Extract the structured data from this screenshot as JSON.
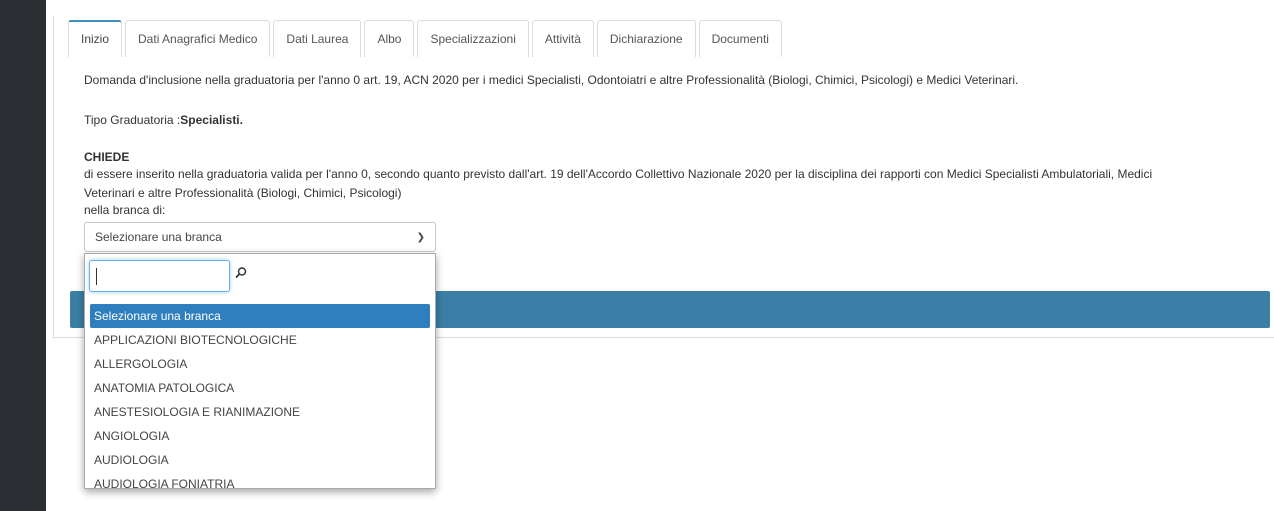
{
  "tabs": [
    "Inizio",
    "Dati Anagrafici Medico",
    "Dati Laurea",
    "Albo",
    "Specializzazioni",
    "Attività",
    "Dichiarazione",
    "Documenti"
  ],
  "content": {
    "intro": "Domanda d'inclusione nella graduatoria per l'anno 0 art. 19, ACN 2020 per i medici Specialisti, Odontoiatri e altre Professionalità (Biologi, Chimici, Psicologi) e Medici Veterinari.",
    "tipo_label": "Tipo Graduatoria :",
    "tipo_value": "Specialisti.",
    "chiede": "CHIEDE",
    "para_line1": "di essere inserito nella graduatoria valida per l'anno 0, secondo quanto previsto dall'art. 19 dell'Accordo Collettivo Nazionale 2020 per la disciplina dei rapporti con Medici Specialisti Ambulatoriali, Medici",
    "para_line2": "Veterinari e altre Professionalità (Biologi, Chimici, Psicologi)",
    "branca_label": "nella branca di:"
  },
  "select": {
    "value": "Selezionare una branca",
    "search_value": "",
    "options": [
      "Selezionare una branca",
      "APPLICAZIONI BIOTECNOLOGICHE",
      "ALLERGOLOGIA",
      "ANATOMIA PATOLOGICA",
      "ANESTESIOLOGIA E RIANIMAZIONE",
      "ANGIOLOGIA",
      "AUDIOLOGIA",
      "AUDIOLOGIA FONIATRIA"
    ]
  }
}
